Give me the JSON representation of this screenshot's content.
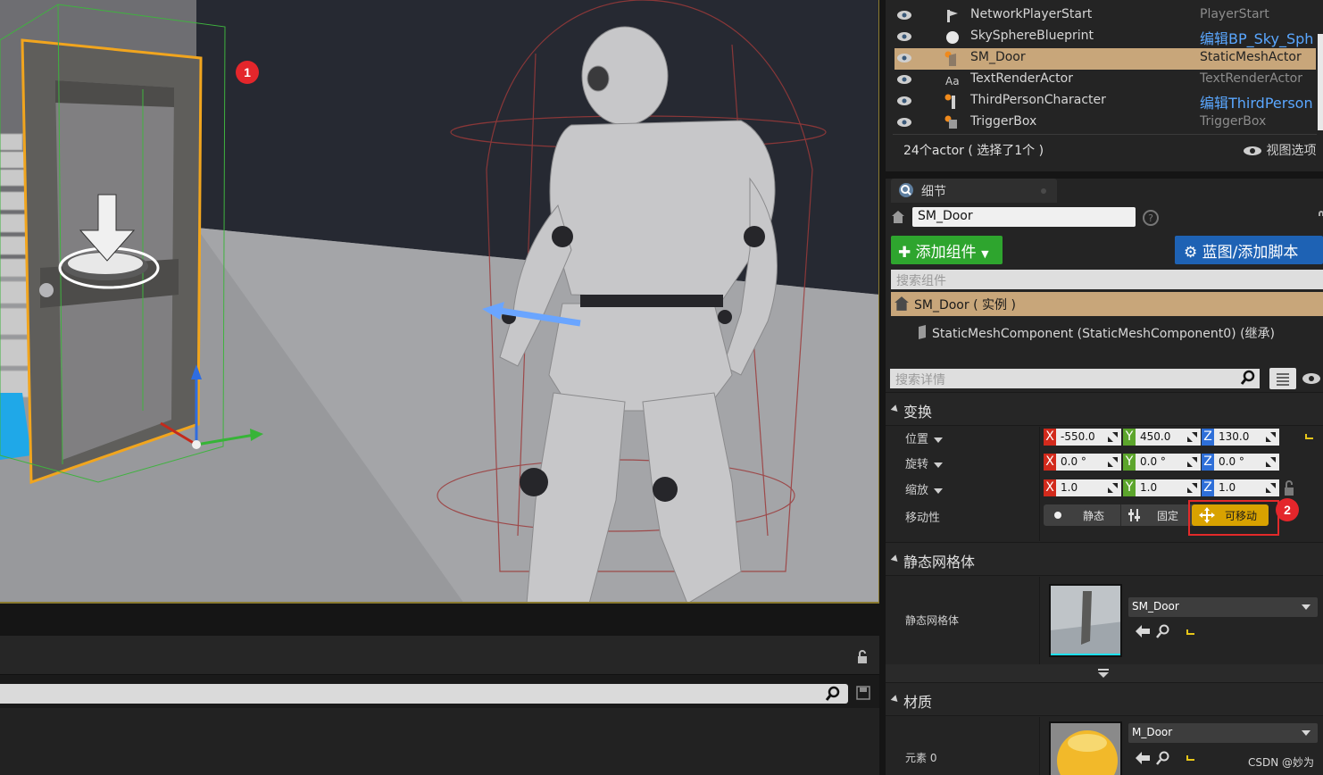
{
  "viewport": {
    "badge1": "1"
  },
  "outliner": {
    "rows": [
      {
        "name": "NetworkPlayerStart",
        "type": "PlayerStart",
        "type_is_link": false,
        "icon": "player-start-icon"
      },
      {
        "name": "SkySphereBlueprint",
        "type": "编辑BP_Sky_Sph",
        "type_is_link": true,
        "icon": "sphere-icon"
      },
      {
        "name": "SM_Door",
        "type": "StaticMeshActor",
        "type_is_link": false,
        "selected": true,
        "icon": "static-mesh-icon"
      },
      {
        "name": "TextRenderActor",
        "type": "TextRenderActor",
        "type_is_link": false,
        "icon": "text-render-icon"
      },
      {
        "name": "ThirdPersonCharacter",
        "type": "编辑ThirdPerson",
        "type_is_link": true,
        "icon": "character-icon"
      },
      {
        "name": "TriggerBox",
        "type": "TriggerBox",
        "type_is_link": false,
        "icon": "trigger-box-icon"
      }
    ],
    "footer": "24个actor ( 选择了1个 )",
    "view_options": "视图选项"
  },
  "details": {
    "tab_label": "细节",
    "actor_name": "SM_Door",
    "add_component": "添加组件",
    "blueprint_script": "蓝图/添加脚本",
    "search_components_placeholder": "搜索组件",
    "component_root": "SM_Door ( 实例 )",
    "component_child": "StaticMeshComponent (StaticMeshComponent0) (继承)",
    "search_details_placeholder": "搜索详情"
  },
  "transform": {
    "section": "变换",
    "location_label": "位置",
    "rotation_label": "旋转",
    "scale_label": "缩放",
    "mobility_label": "移动性",
    "location": {
      "x": "-550.0",
      "y": "450.0",
      "z": "130.0"
    },
    "rotation": {
      "x": "0.0 °",
      "y": "0.0 °",
      "z": "0.0 °"
    },
    "scale": {
      "x": "1.0",
      "y": "1.0",
      "z": "1.0"
    },
    "axis_x": "X",
    "axis_y": "Y",
    "axis_z": "Z",
    "mobility": {
      "static": "静态",
      "stationary": "固定",
      "movable": "可移动",
      "active": "movable"
    },
    "badge2": "2"
  },
  "static_mesh": {
    "section": "静态网格体",
    "label": "静态网格体",
    "asset": "SM_Door"
  },
  "materials": {
    "section": "材质",
    "label": "元素 0",
    "asset": "M_Door"
  },
  "watermark": "CSDN @妙为",
  "colors": {
    "selection": "#c8a67a",
    "add_button": "#2ea52e",
    "blueprint_button": "#1e62b4",
    "movable_active": "#d8a200",
    "axis_x": "#d22a1c",
    "axis_y": "#5ca52c",
    "axis_z": "#2e6fd8",
    "badge": "#e4262b",
    "highlight_box": "#e22a2a"
  }
}
